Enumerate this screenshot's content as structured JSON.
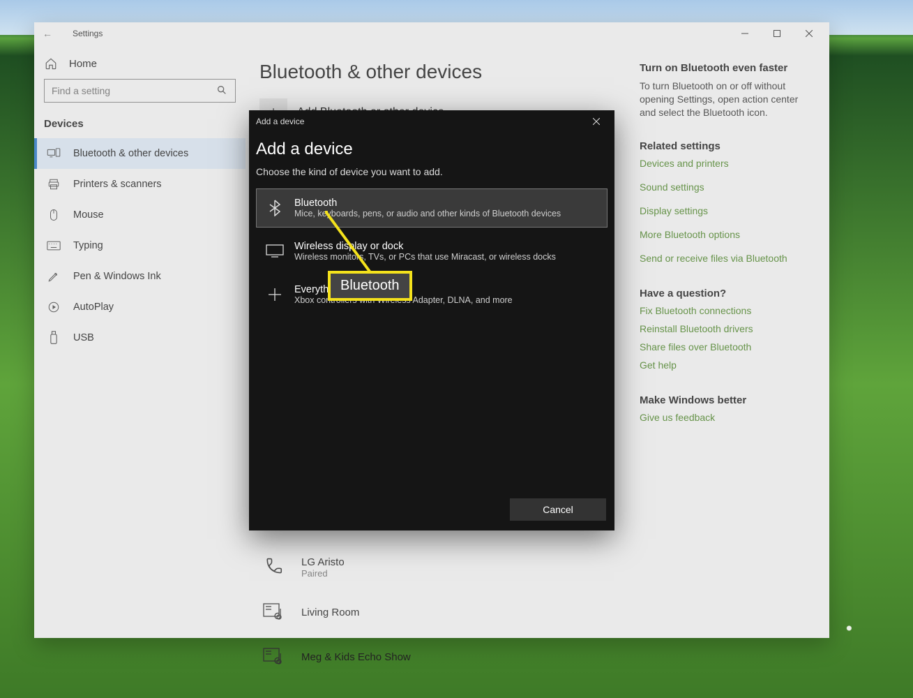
{
  "window": {
    "back_icon": "←",
    "title": "Settings",
    "home_label": "Home",
    "search_placeholder": "Find a setting",
    "group_label": "Devices",
    "nav_items": [
      {
        "icon": "bt-devices",
        "label": "Bluetooth & other devices",
        "active": true
      },
      {
        "icon": "printer",
        "label": "Printers & scanners"
      },
      {
        "icon": "mouse",
        "label": "Mouse"
      },
      {
        "icon": "keyboard",
        "label": "Typing"
      },
      {
        "icon": "pen",
        "label": "Pen & Windows Ink"
      },
      {
        "icon": "autoplay",
        "label": "AutoPlay"
      },
      {
        "icon": "usb",
        "label": "USB"
      }
    ]
  },
  "page": {
    "heading": "Bluetooth & other devices",
    "add_label": "Add Bluetooth or other device",
    "devices": [
      {
        "icon": "phone",
        "name": "LG Aristo",
        "status": "Paired"
      },
      {
        "icon": "media",
        "name": "Living Room",
        "status": ""
      },
      {
        "icon": "media",
        "name": "Meg & Kids Echo Show",
        "status": ""
      }
    ]
  },
  "sidebar_right": {
    "tip_heading": "Turn on Bluetooth even faster",
    "tip_body": "To turn Bluetooth on or off without opening Settings, open action center and select the Bluetooth icon.",
    "related_heading": "Related settings",
    "related_links": [
      "Devices and printers",
      "Sound settings",
      "Display settings",
      "More Bluetooth options",
      "Send or receive files via Bluetooth"
    ],
    "question_heading": "Have a question?",
    "question_links": [
      "Fix Bluetooth connections",
      "Reinstall Bluetooth drivers",
      "Share files over Bluetooth",
      "Get help"
    ],
    "better_heading": "Make Windows better",
    "better_links": [
      "Give us feedback"
    ]
  },
  "dialog": {
    "titlebar": "Add a device",
    "heading": "Add a device",
    "subtitle": "Choose the kind of device you want to add.",
    "options": [
      {
        "icon": "bluetooth",
        "title": "Bluetooth",
        "desc": "Mice, keyboards, pens, or audio and other kinds of Bluetooth devices",
        "selected": true
      },
      {
        "icon": "monitor",
        "title": "Wireless display or dock",
        "desc": "Wireless monitors, TVs, or PCs that use Miracast, or wireless docks"
      },
      {
        "icon": "plus",
        "title": "Everything else",
        "desc": "Xbox controllers with Wireless Adapter, DLNA, and more"
      }
    ],
    "cancel": "Cancel"
  },
  "annotation": {
    "label": "Bluetooth"
  }
}
